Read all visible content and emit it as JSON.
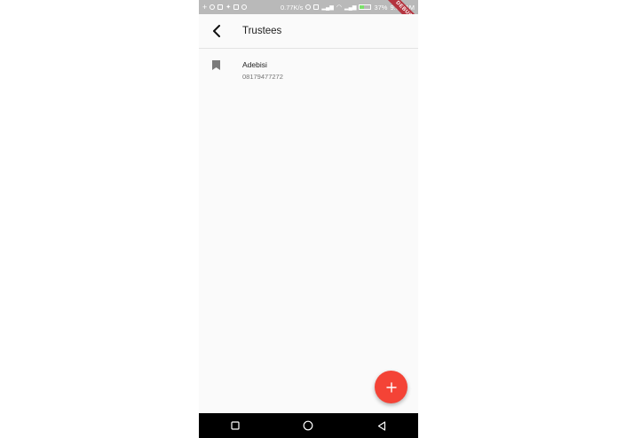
{
  "status_bar": {
    "network_speed": "0.77K/s",
    "battery_percent": "37%",
    "time": "9:05 AM"
  },
  "debug_banner": "DEBUG",
  "app_bar": {
    "title": "Trustees"
  },
  "trustees": [
    {
      "name": "Adebisi",
      "phone": "08179477272"
    }
  ],
  "colors": {
    "fab": "#f44336",
    "debug_banner": "#b4343f",
    "status_bar": "#b9b9b9"
  }
}
